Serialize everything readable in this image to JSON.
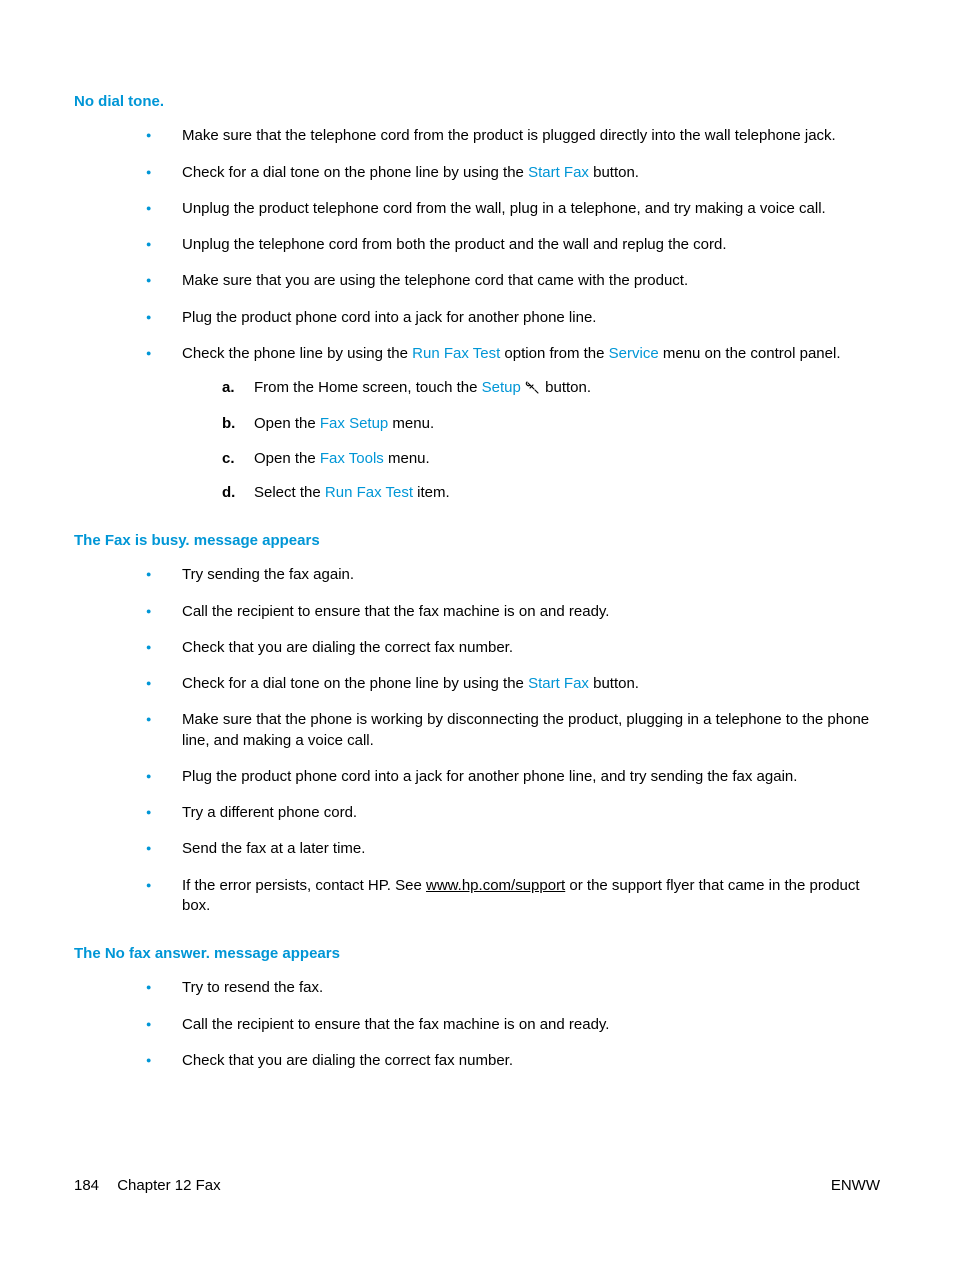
{
  "sections": [
    {
      "heading": "No dial tone.",
      "bullets": [
        {
          "text": "Make sure that the telephone cord from the product is plugged directly into the wall telephone jack."
        },
        {
          "parts": [
            {
              "t": "Check for a dial tone on the phone line by using the "
            },
            {
              "t": "Start Fax",
              "ui": true
            },
            {
              "t": " button."
            }
          ]
        },
        {
          "text": "Unplug the product telephone cord from the wall, plug in a telephone, and try making a voice call."
        },
        {
          "text": "Unplug the telephone cord from both the product and the wall and replug the cord."
        },
        {
          "text": "Make sure that you are using the telephone cord that came with the product."
        },
        {
          "text": "Plug the product phone cord into a jack for another phone line."
        },
        {
          "parts": [
            {
              "t": "Check the phone line by using the "
            },
            {
              "t": "Run Fax Test",
              "ui": true
            },
            {
              "t": " option from the "
            },
            {
              "t": "Service",
              "ui": true
            },
            {
              "t": " menu on the control panel."
            }
          ],
          "steps": [
            {
              "label": "a.",
              "parts": [
                {
                  "t": "From the Home screen, touch the "
                },
                {
                  "t": "Setup",
                  "ui": true
                },
                {
                  "icon": true
                },
                {
                  "t": " button."
                }
              ]
            },
            {
              "label": "b.",
              "parts": [
                {
                  "t": "Open the "
                },
                {
                  "t": "Fax Setup",
                  "ui": true
                },
                {
                  "t": " menu."
                }
              ]
            },
            {
              "label": "c.",
              "parts": [
                {
                  "t": "Open the "
                },
                {
                  "t": "Fax Tools",
                  "ui": true
                },
                {
                  "t": " menu."
                }
              ]
            },
            {
              "label": "d.",
              "parts": [
                {
                  "t": "Select the "
                },
                {
                  "t": "Run Fax Test",
                  "ui": true
                },
                {
                  "t": " item."
                }
              ]
            }
          ]
        }
      ]
    },
    {
      "heading": "The Fax is busy. message appears",
      "bullets": [
        {
          "text": "Try sending the fax again."
        },
        {
          "text": "Call the recipient to ensure that the fax machine is on and ready."
        },
        {
          "text": "Check that you are dialing the correct fax number."
        },
        {
          "parts": [
            {
              "t": "Check for a dial tone on the phone line by using the "
            },
            {
              "t": "Start Fax",
              "ui": true
            },
            {
              "t": " button."
            }
          ]
        },
        {
          "text": "Make sure that the phone is working by disconnecting the product, plugging in a telephone to the phone line, and making a voice call."
        },
        {
          "text": "Plug the product phone cord into a jack for another phone line, and try sending the fax again."
        },
        {
          "text": "Try a different phone cord."
        },
        {
          "text": "Send the fax at a later time."
        },
        {
          "parts": [
            {
              "t": "If the error persists, contact HP. See "
            },
            {
              "t": "www.hp.com/support",
              "link": true
            },
            {
              "t": " or the support flyer that came in the product box."
            }
          ]
        }
      ]
    },
    {
      "heading": "The No fax answer. message appears",
      "bullets": [
        {
          "text": "Try to resend the fax."
        },
        {
          "text": "Call the recipient to ensure that the fax machine is on and ready."
        },
        {
          "text": "Check that you are dialing the correct fax number."
        }
      ]
    }
  ],
  "footer": {
    "page_number": "184",
    "chapter": "Chapter 12   Fax",
    "region": "ENWW"
  }
}
